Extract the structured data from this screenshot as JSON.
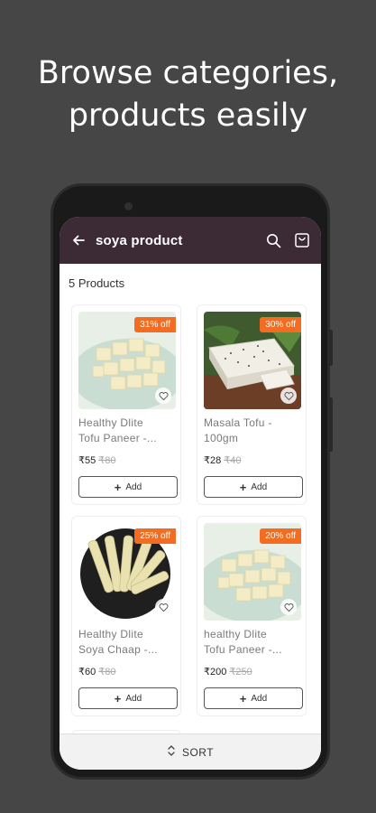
{
  "promo": {
    "line1": "Browse categories,",
    "line2": "products easily"
  },
  "appbar": {
    "title": "soya product",
    "back_icon": "arrow-left-icon",
    "search_icon": "search-icon",
    "cart_icon": "shopping-bag-icon",
    "bg_color": "#3c2a35"
  },
  "products_count": "5 Products",
  "accent_color": "#f26d21",
  "products": [
    {
      "badge": "31% off",
      "name_line1": "Healthy Dlite",
      "name_line2": "Tofu Paneer -...",
      "price": "₹55",
      "old_price": "₹80",
      "add_label": "Add",
      "image": "paneer-cubes"
    },
    {
      "badge": "30% off",
      "name_line1": "Masala Tofu -",
      "name_line2": "100gm",
      "price": "₹28",
      "old_price": "₹40",
      "add_label": "Add",
      "image": "masala-tofu-slab"
    },
    {
      "badge": "25% off",
      "name_line1": "Healthy Dlite",
      "name_line2": "Soya Chaap -...",
      "price": "₹60",
      "old_price": "₹80",
      "add_label": "Add",
      "image": "soya-chaap-sticks"
    },
    {
      "badge": "20% off",
      "name_line1": "healthy Dlite",
      "name_line2": "Tofu Paneer -...",
      "price": "₹200",
      "old_price": "₹250",
      "add_label": "Add",
      "image": "paneer-cubes"
    }
  ],
  "sort_label": "SORT",
  "sort_icon": "sort-arrows-icon"
}
